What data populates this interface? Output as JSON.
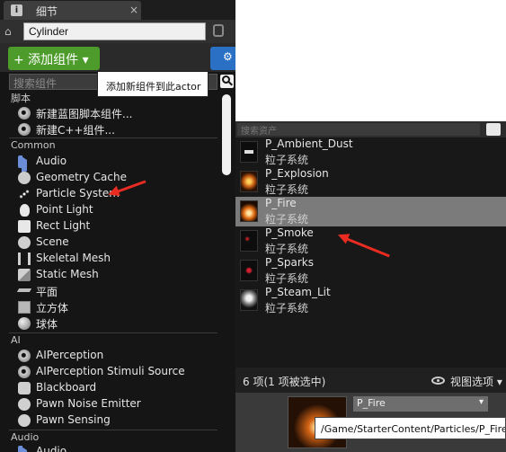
{
  "details_panel": {
    "tab_label": "细节",
    "tab_close": "×",
    "actor_name": "Cylinder",
    "add_component_label": "+ 添加组件 ▾",
    "search_placeholder": "搜索组件",
    "add_component_tooltip": "添加新组件到此actor",
    "categories": {
      "script": "脚本",
      "common": "Common",
      "ai": "AI",
      "audio": "Audio"
    },
    "script_items": [
      "新建蓝图脚本组件...",
      "新建C++组件..."
    ],
    "common_items": [
      "Audio",
      "Geometry Cache",
      "Particle System",
      "Point Light",
      "Rect Light",
      "Scene",
      "Skeletal Mesh",
      "Static Mesh",
      "平面",
      "立方体",
      "球体"
    ],
    "ai_items": [
      "AIPerception",
      "AIPerception Stimuli Source",
      "Blackboard",
      "Pawn Noise Emitter",
      "Pawn Sensing"
    ],
    "audio_items": [
      "Audio"
    ]
  },
  "asset_picker": {
    "search_partial": "搜索资产",
    "assets": [
      {
        "name": "P_Ambient_Dust",
        "type": "粒子系统",
        "selected": false
      },
      {
        "name": "P_Explosion",
        "type": "粒子系统",
        "selected": false
      },
      {
        "name": "P_Fire",
        "type": "粒子系统",
        "selected": true
      },
      {
        "name": "P_Smoke",
        "type": "粒子系统",
        "selected": false
      },
      {
        "name": "P_Sparks",
        "type": "粒子系统",
        "selected": false
      },
      {
        "name": "P_Steam_Lit",
        "type": "粒子系统",
        "selected": false
      }
    ],
    "status_count": "6 项(1 项被选中)",
    "view_options": "视图选项 ▾",
    "selected_asset": "P_Fire",
    "asset_path": "/Game/StarterContent/Particles/P_Fire"
  },
  "colors": {
    "add_button": "#4d9c2b",
    "annotation_arrow": "#e82c22",
    "selected_row": "#7b7b7b"
  }
}
